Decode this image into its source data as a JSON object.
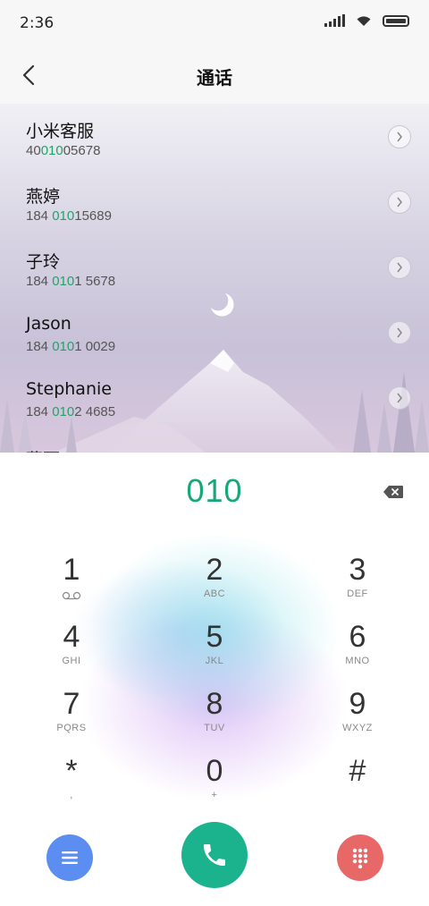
{
  "status_bar": {
    "time": "2:36"
  },
  "header": {
    "title": "通话"
  },
  "contacts": [
    {
      "name": "小米客服",
      "number_pre": "40",
      "number_hl": "010",
      "number_post": "05678"
    },
    {
      "name": "燕婷",
      "number_pre": "184 ",
      "number_hl": "010",
      "number_post": "15689"
    },
    {
      "name": "子玲",
      "number_pre": "184 ",
      "number_hl": "010",
      "number_post": "1 5678"
    },
    {
      "name": "Jason",
      "number_pre": "184 ",
      "number_hl": "010",
      "number_post": "1 0029"
    },
    {
      "name": "Stephanie",
      "number_pre": "184 ",
      "number_hl": "010",
      "number_post": "2 4685"
    }
  ],
  "contact_partial": "燕丽",
  "dialpad": {
    "input_value": "010",
    "keys": [
      {
        "digit": "1",
        "letters": ""
      },
      {
        "digit": "2",
        "letters": "ABC"
      },
      {
        "digit": "3",
        "letters": "DEF"
      },
      {
        "digit": "4",
        "letters": "GHI"
      },
      {
        "digit": "5",
        "letters": "JKL"
      },
      {
        "digit": "6",
        "letters": "MNO"
      },
      {
        "digit": "7",
        "letters": "PQRS"
      },
      {
        "digit": "8",
        "letters": "TUV"
      },
      {
        "digit": "9",
        "letters": "WXYZ"
      },
      {
        "digit": "*",
        "letters": ","
      },
      {
        "digit": "0",
        "letters": "+"
      },
      {
        "digit": "#",
        "letters": ""
      }
    ]
  },
  "colors": {
    "highlight": "#21a36b",
    "menu_button": "#5b8ef0",
    "call_button": "#1ab38e",
    "keypad_button": "#e86868"
  },
  "icons": [
    "back-arrow-icon",
    "wifi-icon",
    "signal-icon",
    "battery-icon",
    "chevron-right-icon",
    "voicemail-icon",
    "backspace-icon",
    "menu-icon",
    "phone-icon",
    "dialpad-icon"
  ]
}
